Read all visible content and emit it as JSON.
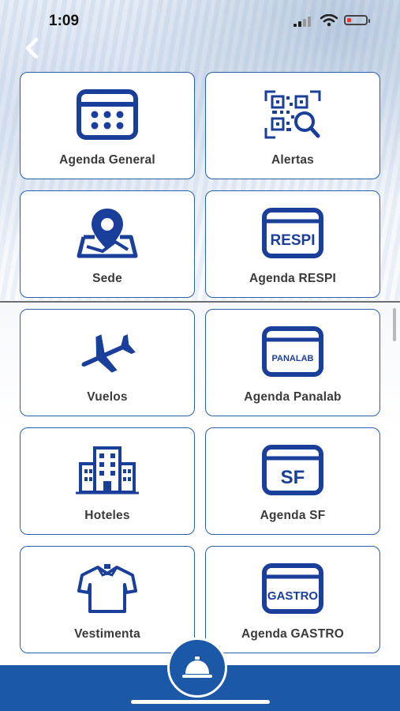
{
  "status_bar": {
    "time": "1:09"
  },
  "colors": {
    "primary": "#1c58a8",
    "icon": "#1a3f9a",
    "tile_border": "#2b5ea8",
    "battery_low": "#e53935"
  },
  "tiles": [
    {
      "label": "Agenda General",
      "icon": "calendar-icon"
    },
    {
      "label": "Alertas",
      "icon": "qr-search-icon"
    },
    {
      "label": "Sede",
      "icon": "map-pin-icon"
    },
    {
      "label": "Agenda RESPI",
      "icon": "respi-calendar-icon",
      "icon_text": "RESPI"
    },
    {
      "label": "Vuelos",
      "icon": "airplane-icon"
    },
    {
      "label": "Agenda Panalab",
      "icon": "panalab-calendar-icon",
      "icon_text": "PANALAB"
    },
    {
      "label": "Hoteles",
      "icon": "building-icon"
    },
    {
      "label": "Agenda SF",
      "icon": "sf-calendar-icon",
      "icon_text": "SF"
    },
    {
      "label": "Vestimenta",
      "icon": "shirt-icon"
    },
    {
      "label": "Agenda GASTRO",
      "icon": "gastro-calendar-icon",
      "icon_text": "GASTRO"
    }
  ],
  "footer": {
    "center_button_icon": "service-bell-icon"
  }
}
